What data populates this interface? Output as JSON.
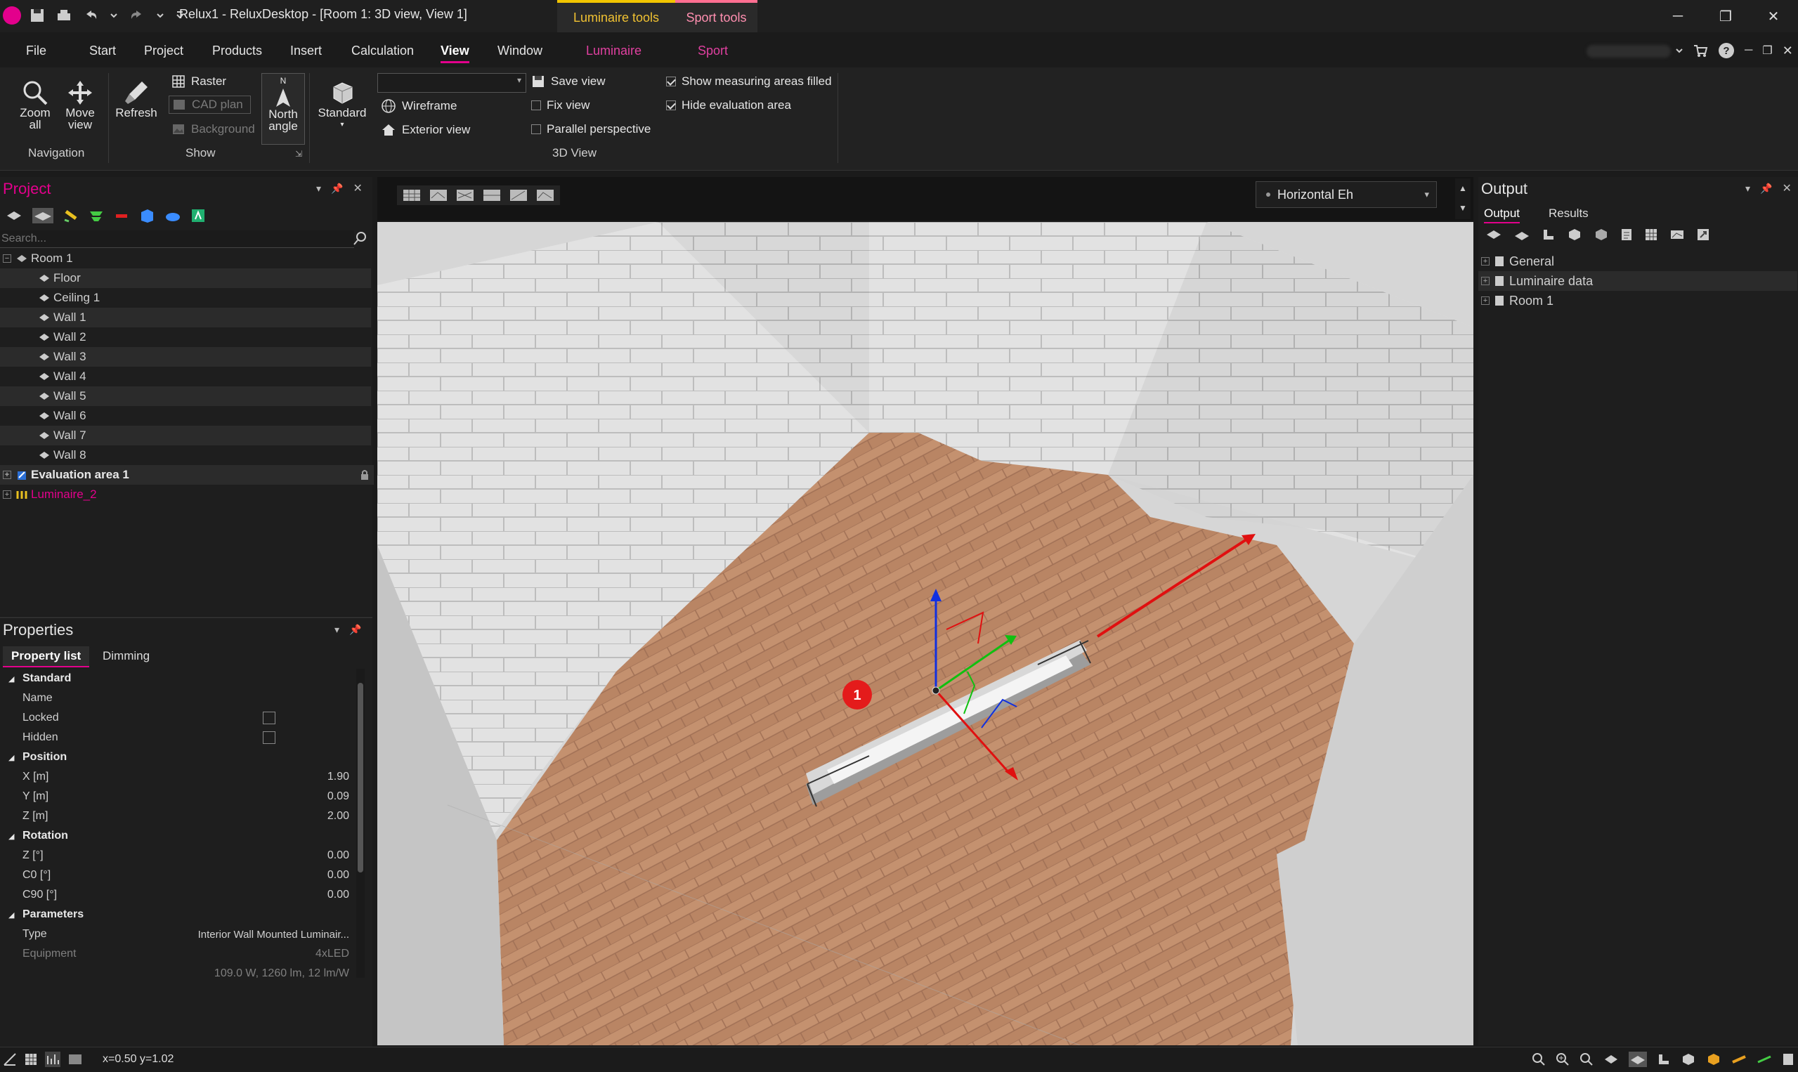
{
  "titlebar": {
    "title": "Relux1 - ReluxDesktop - [Room 1: 3D view, View 1]",
    "context_tabs": [
      "Luminaire tools",
      "Sport tools"
    ]
  },
  "menu": {
    "items": [
      "File",
      "Start",
      "Project",
      "Products",
      "Insert",
      "Calculation",
      "View",
      "Window",
      "Luminaire",
      "Sport"
    ],
    "active": "View"
  },
  "ribbon": {
    "navigation": {
      "label": "Navigation",
      "zoom_all": "Zoom all",
      "move_view": "Move view"
    },
    "show": {
      "label": "Show",
      "refresh": "Refresh",
      "raster": "Raster",
      "cad_plan": "CAD plan",
      "background": "Background",
      "north_angle": "North angle",
      "north_letter": "N"
    },
    "view3d": {
      "label": "3D View",
      "standard": "Standard",
      "wireframe": "Wireframe",
      "exterior_view": "Exterior view",
      "save_view": "Save view",
      "fix_view": "Fix view",
      "parallel_perspective": "Parallel perspective",
      "show_measuring_filled": "Show measuring areas filled",
      "hide_evaluation_area": "Hide evaluation area",
      "view_combo_value": ""
    }
  },
  "project": {
    "title": "Project",
    "search_placeholder": "Search...",
    "tree": {
      "room": "Room 1",
      "children": [
        "Floor",
        "Ceiling 1",
        "Wall 1",
        "Wall 2",
        "Wall 3",
        "Wall 4",
        "Wall 5",
        "Wall 6",
        "Wall 7",
        "Wall 8"
      ],
      "evaluation": "Evaluation area 1",
      "luminaire": "Luminaire_2"
    }
  },
  "properties": {
    "title": "Properties",
    "tabs": [
      "Property list",
      "Dimming"
    ],
    "rows": {
      "standard": "Standard",
      "name": "Name",
      "locked": "Locked",
      "hidden": "Hidden",
      "position": "Position",
      "x_label": "X [m]",
      "x_value": "1.90",
      "y_label": "Y [m]",
      "y_value": "0.09",
      "z_label": "Z [m]",
      "z_value": "2.00",
      "rotation": "Rotation",
      "rz_label": "Z [°]",
      "rz_value": "0.00",
      "c0_label": "C0 [°]",
      "c0_value": "0.00",
      "c90_label": "C90 [°]",
      "c90_value": "0.00",
      "parameters": "Parameters",
      "type_label": "Type",
      "type_value": "Interior Wall Mounted Luminair...",
      "equipment_label": "Equipment",
      "equipment_value": "4xLED",
      "equipment_detail": "109.0 W, 1260 lm, 12 lm/W"
    }
  },
  "viewport": {
    "calc_combo": "Horizontal Eh",
    "marker_label": "1"
  },
  "output": {
    "title": "Output",
    "tabs": [
      "Output",
      "Results"
    ],
    "tree": [
      "General",
      "Luminaire data",
      "Room 1"
    ]
  },
  "statusbar": {
    "coords": "x=0.50 y=1.02"
  },
  "colors": {
    "accent": "#e3008c",
    "luminaire_tab": "#f2c500",
    "sport_tab": "#ff6f91",
    "axis_x": "#e01010",
    "axis_y": "#10c010",
    "axis_z": "#1030e0"
  }
}
